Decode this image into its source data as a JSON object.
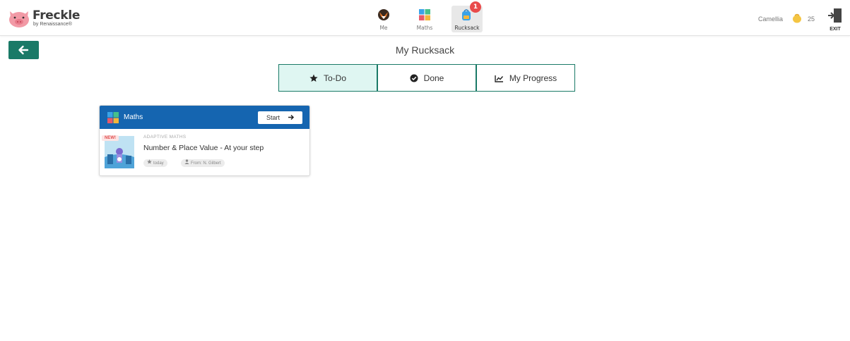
{
  "app": {
    "brand": "Freckle",
    "brand_sub": "by Renaissance®"
  },
  "nav": {
    "tabs": [
      {
        "label": "Me",
        "icon": "fox-avatar-icon"
      },
      {
        "label": "Maths",
        "icon": "maths-blocks-icon"
      },
      {
        "label": "Rucksack",
        "icon": "rucksack-icon",
        "badge": "1",
        "active": true
      }
    ]
  },
  "user": {
    "name": "Camellia",
    "coins": "25",
    "exit_label": "EXIT"
  },
  "page": {
    "title": "My Rucksack",
    "back_icon": "arrow-left-icon"
  },
  "tabs": [
    {
      "label": "To-Do",
      "icon": "star-icon",
      "active": true
    },
    {
      "label": "Done",
      "icon": "check-circle-icon"
    },
    {
      "label": "My Progress",
      "icon": "chart-line-icon"
    }
  ],
  "assignment": {
    "subject": "Maths",
    "start_label": "Start",
    "new_badge": "NEW!",
    "kicker": "ADAPTIVE MATHS",
    "title": "Number & Place Value - At your step",
    "due": "today",
    "from": "From: N. Gilbert"
  },
  "colors": {
    "accent": "#1a7a67",
    "active_tab_bg": "#dff6f2",
    "card_header": "#1565b0",
    "badge_red": "#e94b4b"
  }
}
